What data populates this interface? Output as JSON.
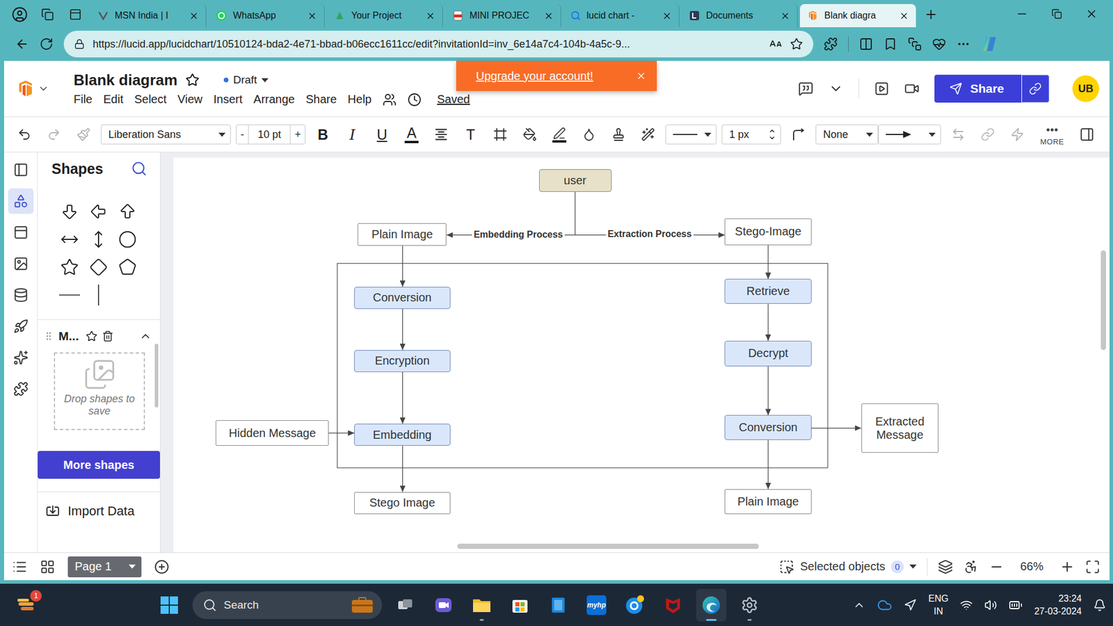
{
  "browser": {
    "tabs": [
      {
        "label": "MSN India | I",
        "selected": false
      },
      {
        "label": "WhatsApp",
        "selected": false
      },
      {
        "label": "Your Project",
        "selected": false
      },
      {
        "label": "MINI PROJEC",
        "selected": false
      },
      {
        "label": "lucid chart -",
        "selected": false
      },
      {
        "label": "Documents",
        "selected": false
      },
      {
        "label": "Blank diagra",
        "selected": true
      }
    ],
    "url": "https://lucid.app/lucidchart/10510124-bda2-4e71-bbad-b06ecc1611cc/edit?invitationId=inv_6e14a7c4-104b-4a5c-9..."
  },
  "header": {
    "title": "Blank diagram",
    "status": "Draft",
    "menu": [
      "File",
      "Edit",
      "Select",
      "View",
      "Insert",
      "Arrange",
      "Share",
      "Help"
    ],
    "saved": "Saved",
    "banner": "Upgrade your account!",
    "share": "Share",
    "avatar": "UB"
  },
  "toolbar": {
    "font": "Liberation Sans",
    "decrease": "-",
    "size": "10 pt",
    "increase": "+",
    "bold": "B",
    "italic": "I",
    "underline": "U",
    "font_color": "A",
    "text_options": "T",
    "line_width": "1 px",
    "line_start": "None",
    "more": "MORE"
  },
  "rail": [
    {
      "selected": false
    },
    {
      "selected": true
    },
    {
      "selected": false
    },
    {
      "selected": false
    },
    {
      "selected": false
    },
    {
      "selected": false
    },
    {
      "selected": false
    },
    {
      "selected": false
    }
  ],
  "shapes": {
    "title": "Shapes",
    "library": "M...",
    "drop_hint": "Drop shapes to save",
    "more": "More shapes",
    "import": "Import Data"
  },
  "diagram": {
    "nodes": [
      {
        "label": "user",
        "kind": "terminal"
      },
      {
        "label": "Plain Image",
        "kind": "data"
      },
      {
        "label": "Stego-Image",
        "kind": "data"
      },
      {
        "label": "Conversion",
        "kind": "process"
      },
      {
        "label": "Encryption",
        "kind": "process"
      },
      {
        "label": "Embedding",
        "kind": "process"
      },
      {
        "label": "Hidden Message",
        "kind": "data"
      },
      {
        "label": "Stego Image",
        "kind": "data"
      },
      {
        "label": "Retrieve",
        "kind": "process"
      },
      {
        "label": "Decrypt",
        "kind": "process"
      },
      {
        "label": "Conversion",
        "kind": "process"
      },
      {
        "label": "Extracted Message",
        "kind": "data"
      },
      {
        "label": "Plain Image",
        "kind": "data"
      }
    ],
    "edge_labels": [
      "Embedding Process",
      "Extraction Process"
    ]
  },
  "footer": {
    "page": "Page 1",
    "selected_label": "Selected objects",
    "selected_count": "0",
    "zoom": "66%"
  },
  "taskbar": {
    "badge": "1",
    "search": "Search",
    "apps": [
      {
        "label": "",
        "running": false,
        "selected": false
      },
      {
        "label": "",
        "running": false,
        "selected": false
      },
      {
        "label": "",
        "running": true,
        "selected": false
      },
      {
        "label": "",
        "running": false,
        "selected": false
      },
      {
        "label": "",
        "running": false,
        "selected": false
      },
      {
        "label": "myhp",
        "running": false,
        "selected": false
      },
      {
        "label": "",
        "running": false,
        "selected": false
      },
      {
        "label": "",
        "running": false,
        "selected": false
      },
      {
        "label": "",
        "running": true,
        "selected": true
      },
      {
        "label": "",
        "running": true,
        "selected": false
      }
    ],
    "language": "ENG",
    "region": "IN",
    "time": "23:24",
    "date": "27-03-2024"
  }
}
